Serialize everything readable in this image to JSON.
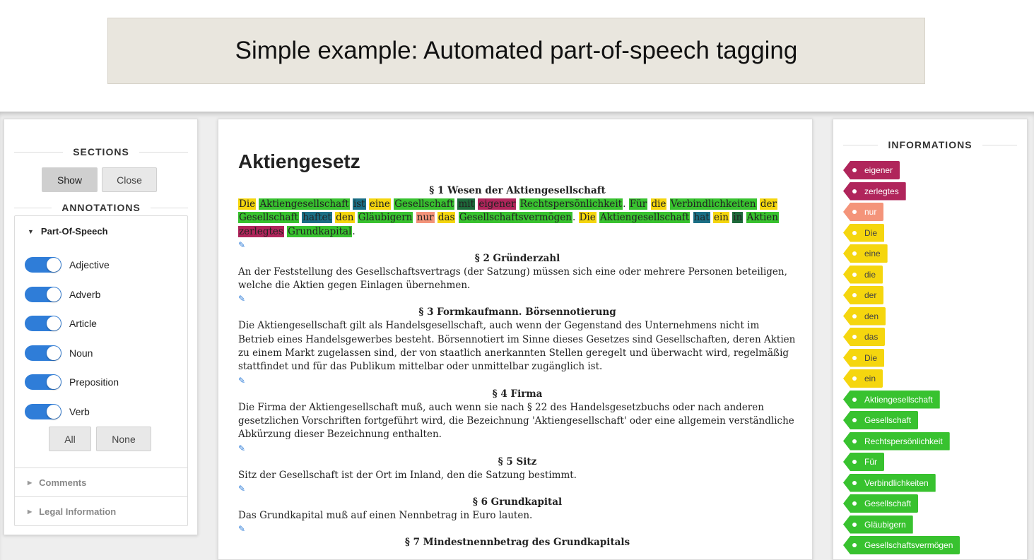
{
  "banner": {
    "title": "Simple example: Automated part-of-speech tagging"
  },
  "left": {
    "sections_heading": "SECTIONS",
    "show_label": "Show",
    "close_label": "Close",
    "annotations_heading": "ANNOTATIONS",
    "pos_heading": "Part-Of-Speech",
    "toggles": [
      {
        "label": "Adjective",
        "on": true
      },
      {
        "label": "Adverb",
        "on": true
      },
      {
        "label": "Article",
        "on": true
      },
      {
        "label": "Noun",
        "on": true
      },
      {
        "label": "Preposition",
        "on": true
      },
      {
        "label": "Verb",
        "on": true
      }
    ],
    "all_label": "All",
    "none_label": "None",
    "comments_label": "Comments",
    "legal_label": "Legal Information"
  },
  "doc": {
    "title": "Aktiengesetz",
    "sections": [
      {
        "heading": "§ 1 Wesen der Aktiengesellschaft",
        "tokens": [
          {
            "t": "Die",
            "c": "art"
          },
          {
            "t": " "
          },
          {
            "t": "Aktiengesellschaft",
            "c": "noun"
          },
          {
            "t": " "
          },
          {
            "t": "ist",
            "c": "verb"
          },
          {
            "t": " "
          },
          {
            "t": "eine",
            "c": "art"
          },
          {
            "t": " "
          },
          {
            "t": "Gesellschaft",
            "c": "noun"
          },
          {
            "t": " "
          },
          {
            "t": "mit",
            "c": "prep"
          },
          {
            "t": " "
          },
          {
            "t": "eigener",
            "c": "adj"
          },
          {
            "t": " "
          },
          {
            "t": "Rechtspersönlichkeit",
            "c": "noun"
          },
          {
            "t": ". "
          },
          {
            "t": "Für",
            "c": "noun"
          },
          {
            "t": " "
          },
          {
            "t": "die",
            "c": "art"
          },
          {
            "t": " "
          },
          {
            "t": "Verbindlichkeiten",
            "c": "noun"
          },
          {
            "t": " "
          },
          {
            "t": "der",
            "c": "art"
          },
          {
            "t": " "
          },
          {
            "t": "Gesellschaft",
            "c": "noun"
          },
          {
            "t": " "
          },
          {
            "t": "haftet",
            "c": "verb"
          },
          {
            "t": " "
          },
          {
            "t": "den",
            "c": "art"
          },
          {
            "t": " "
          },
          {
            "t": "Gläubigern",
            "c": "noun"
          },
          {
            "t": " "
          },
          {
            "t": "nur",
            "c": "adv"
          },
          {
            "t": " "
          },
          {
            "t": "das",
            "c": "art"
          },
          {
            "t": " "
          },
          {
            "t": "Gesellschaftsvermögen",
            "c": "noun"
          },
          {
            "t": ". "
          },
          {
            "t": "Die",
            "c": "art"
          },
          {
            "t": " "
          },
          {
            "t": "Aktiengesellschaft",
            "c": "noun"
          },
          {
            "t": " "
          },
          {
            "t": "hat",
            "c": "verb"
          },
          {
            "t": " "
          },
          {
            "t": "ein",
            "c": "art"
          },
          {
            "t": " "
          },
          {
            "t": "in",
            "c": "prep"
          },
          {
            "t": " "
          },
          {
            "t": "Aktien",
            "c": "noun"
          },
          {
            "t": " "
          },
          {
            "t": "zerlegtes",
            "c": "adj"
          },
          {
            "t": " "
          },
          {
            "t": "Grundkapital",
            "c": "noun"
          },
          {
            "t": "."
          }
        ]
      },
      {
        "heading": "§ 2 Gründerzahl",
        "text": "An der Feststellung des Gesellschaftsvertrags (der Satzung) müssen sich eine oder mehrere Personen beteiligen, welche die Aktien gegen Einlagen übernehmen."
      },
      {
        "heading": "§ 3 Formkaufmann. Börsennotierung",
        "text": "Die Aktiengesellschaft gilt als Handelsgesellschaft, auch wenn der Gegenstand des Unternehmens nicht im Betrieb eines Handelsgewerbes besteht. Börsennotiert im Sinne dieses Gesetzes sind Gesellschaften, deren Aktien zu einem Markt zugelassen sind, der von staatlich anerkannten Stellen geregelt und überwacht wird, regelmäßig stattfindet und für das Publikum mittelbar oder unmittelbar zugänglich ist."
      },
      {
        "heading": "§ 4 Firma",
        "text": "Die Firma der Aktiengesellschaft muß, auch wenn sie nach § 22 des Handelsgesetzbuchs oder nach anderen gesetzlichen Vorschriften fortgeführt wird, die Bezeichnung 'Aktiengesellschaft' oder eine allgemein verständliche Abkürzung dieser Bezeichnung enthalten."
      },
      {
        "heading": "§ 5 Sitz",
        "text": "Sitz der Gesellschaft ist der Ort im Inland, den die Satzung bestimmt."
      },
      {
        "heading": "§ 6 Grundkapital",
        "text": "Das Grundkapital muß auf einen Nennbetrag in Euro lauten."
      },
      {
        "heading": "§ 7 Mindestnennbetrag des Grundkapitals",
        "text": ""
      }
    ]
  },
  "right": {
    "heading": "INFORMATIONS",
    "tags": [
      {
        "label": "eigener",
        "c": "adj"
      },
      {
        "label": "zerlegtes",
        "c": "adj"
      },
      {
        "label": "nur",
        "c": "adv"
      },
      {
        "label": "Die",
        "c": "art"
      },
      {
        "label": "eine",
        "c": "art"
      },
      {
        "label": "die",
        "c": "art"
      },
      {
        "label": "der",
        "c": "art"
      },
      {
        "label": "den",
        "c": "art"
      },
      {
        "label": "das",
        "c": "art"
      },
      {
        "label": "Die",
        "c": "art"
      },
      {
        "label": "ein",
        "c": "art"
      },
      {
        "label": "Aktiengesellschaft",
        "c": "noun"
      },
      {
        "label": "Gesellschaft",
        "c": "noun"
      },
      {
        "label": "Rechtspersönlichkeit",
        "c": "noun"
      },
      {
        "label": "Für",
        "c": "noun"
      },
      {
        "label": "Verbindlichkeiten",
        "c": "noun"
      },
      {
        "label": "Gesellschaft",
        "c": "noun"
      },
      {
        "label": "Gläubigern",
        "c": "noun"
      },
      {
        "label": "Gesellschaftsvermögen",
        "c": "noun"
      }
    ]
  },
  "colors": {
    "article": "#f5d60e",
    "noun": "#38c22f",
    "verb": "#1b6f86",
    "preposition": "#1d6a3a",
    "adjective": "#b0255b",
    "adverb": "#f4947a",
    "toggle": "#2f7dd8"
  },
  "icons": {
    "edit": "pencil-icon",
    "expand": "caret-down-icon",
    "collapsed": "caret-right-icon"
  }
}
